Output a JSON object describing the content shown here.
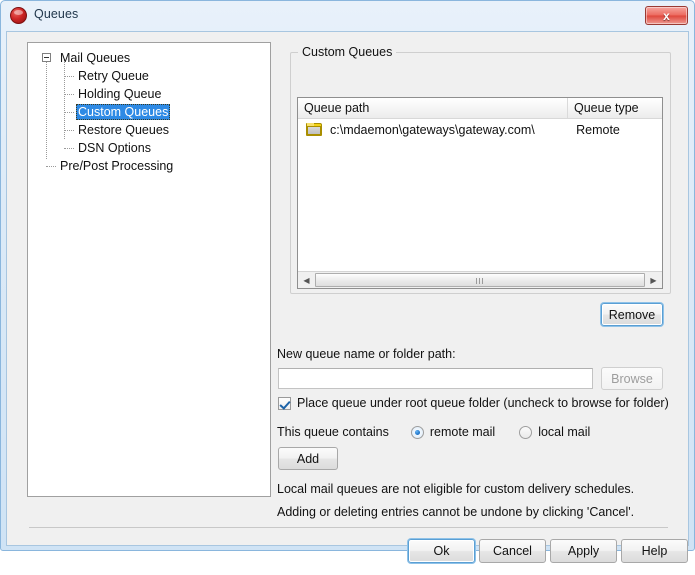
{
  "window": {
    "title": "Queues",
    "app_icon": "mdaemon-icon",
    "close_label": "x"
  },
  "tree": {
    "nodes": [
      {
        "label": "Mail Queues",
        "level": 0,
        "selected": false,
        "expander": "collapse-minus"
      },
      {
        "label": "Retry Queue",
        "level": 1,
        "selected": false
      },
      {
        "label": "Holding Queue",
        "level": 1,
        "selected": false
      },
      {
        "label": "Custom Queues",
        "level": 1,
        "selected": true
      },
      {
        "label": "Restore Queues",
        "level": 1,
        "selected": false
      },
      {
        "label": "DSN Options",
        "level": 1,
        "selected": false
      },
      {
        "label": "Pre/Post Processing",
        "level": 0,
        "selected": false
      }
    ]
  },
  "group": {
    "title": "Custom Queues"
  },
  "listview": {
    "columns": [
      "Queue path",
      "Queue type"
    ],
    "rows": [
      {
        "icon": "folder-icon",
        "path": "c:\\mdaemon\\gateways\\gateway.com\\",
        "type": "Remote"
      }
    ],
    "scrollbar": {
      "left_arrow": "◀",
      "right_arrow": "▶"
    }
  },
  "buttons": {
    "remove": "Remove",
    "browse": "Browse",
    "add": "Add",
    "ok": "Ok",
    "cancel": "Cancel",
    "apply": "Apply",
    "help": "Help"
  },
  "form": {
    "new_queue_label": "New queue name or folder path:",
    "new_queue_value": "",
    "new_queue_placeholder": "",
    "checkbox_label": "Place queue under root queue folder (uncheck to browse for folder)",
    "checkbox_checked": true,
    "radio_prompt": "This queue contains",
    "radio_options": [
      {
        "label": "remote mail",
        "selected": true
      },
      {
        "label": "local mail",
        "selected": false
      }
    ]
  },
  "notes": {
    "note1": "Local mail queues are not eligible for custom delivery schedules.",
    "note2": "Adding or deleting entries cannot be undone by clicking 'Cancel'."
  },
  "colors": {
    "selection_blue": "#2e8ae5",
    "folder_yellow": "#f4d316",
    "close_red": "#df473c",
    "focus_blue": "#5a9fd4"
  }
}
